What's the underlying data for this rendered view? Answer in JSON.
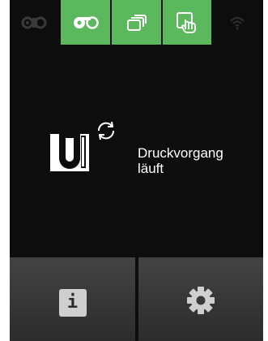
{
  "status_bar": {
    "icons": [
      {
        "name": "ribbon-icon",
        "state": "inactive"
      },
      {
        "name": "label-roll-icon",
        "state": "active"
      },
      {
        "name": "stack-icon",
        "state": "active"
      },
      {
        "name": "touch-icon",
        "state": "active"
      },
      {
        "name": "wifi-icon",
        "state": "inactive"
      }
    ],
    "accent_color": "#5cb85c"
  },
  "main": {
    "status_text": "Druckvorgang läuft",
    "icons": [
      "tube-rack-icon",
      "sync-icon"
    ]
  },
  "bottom_bar": {
    "info_label": "i",
    "settings_icon": "gear-icon"
  }
}
